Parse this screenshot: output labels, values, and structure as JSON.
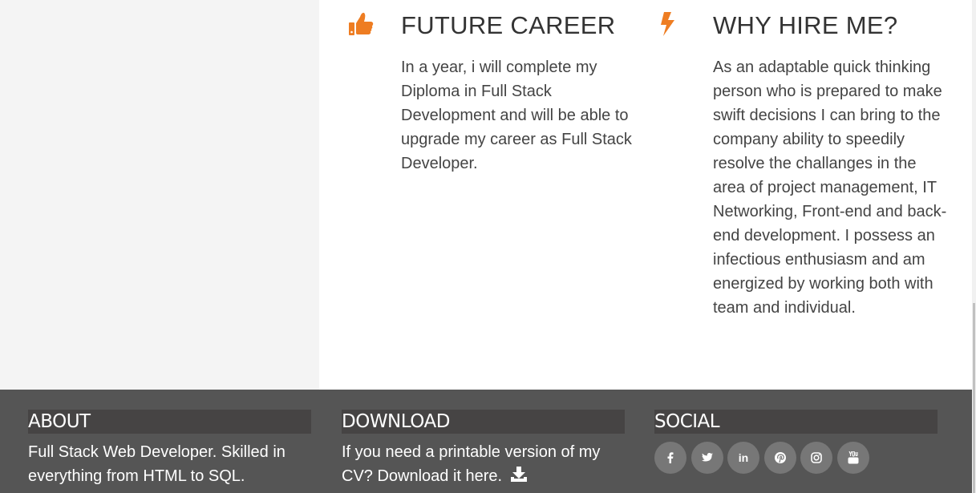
{
  "sections": {
    "future_career": {
      "title": "FUTURE CAREER",
      "icon": "thumbs-up-icon",
      "text": "In a year, i will complete my Diploma in Full Stack Development and will be able to upgrade my career as Full Stack Developer."
    },
    "why_hire": {
      "title": "WHY HIRE ME?",
      "icon": "lightning-bolt-icon",
      "text": "As an adaptable quick thinking person who is prepared to make swift decisions I can bring to the company ability to speedily resolve the challanges in the area of project management, IT Networking, Front-end and back-end development. I possess an infectious enthusiasm and am energized by working both with team and individual."
    }
  },
  "footer": {
    "about": {
      "heading": "ABOUT",
      "text": "Full Stack Web Developer. Skilled in everything from HTML to SQL."
    },
    "download": {
      "heading": "DOWNLOAD",
      "text": "If you need a printable version of my CV? Download it here.",
      "icon": "download-icon"
    },
    "social": {
      "heading": "SOCIAL",
      "links": [
        {
          "name": "facebook",
          "icon": "facebook-icon"
        },
        {
          "name": "twitter",
          "icon": "twitter-icon"
        },
        {
          "name": "linkedin",
          "icon": "linkedin-icon",
          "glyph": "in"
        },
        {
          "name": "pinterest",
          "icon": "pinterest-icon"
        },
        {
          "name": "instagram",
          "icon": "instagram-icon"
        },
        {
          "name": "youtube",
          "icon": "youtube-icon"
        }
      ]
    }
  },
  "colors": {
    "accent": "#ee7d22",
    "footer_bg": "#555555",
    "footer_heading_bg": "#464444",
    "social_button_bg": "#777777",
    "left_panel_bg": "#f4f4f4"
  }
}
